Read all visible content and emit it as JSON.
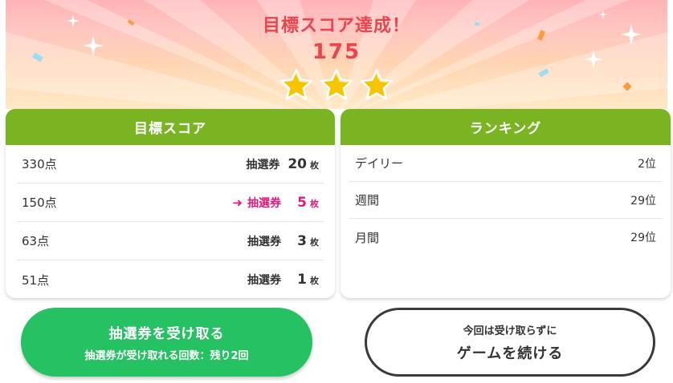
{
  "banner": {
    "title": "目標スコア達成！",
    "score": "175",
    "stars_filled": 3,
    "stars_total": 3,
    "colors": {
      "title": "#e8454f",
      "star": "#f7c500"
    }
  },
  "target_panel": {
    "header": "目標スコア",
    "rows": [
      {
        "score": "330点",
        "prize_label": "抽選券",
        "count": "20",
        "unit": "枚",
        "current": false
      },
      {
        "score": "150点",
        "prize_label": "抽選券",
        "count": "5",
        "unit": "枚",
        "current": true
      },
      {
        "score": "63点",
        "prize_label": "抽選券",
        "count": "3",
        "unit": "枚",
        "current": false
      },
      {
        "score": "51点",
        "prize_label": "抽選券",
        "count": "1",
        "unit": "枚",
        "current": false
      }
    ],
    "current_indicator_icon": "arrow-right-icon",
    "colors": {
      "header": "#7ab422",
      "current": "#e0197d"
    }
  },
  "ranking_panel": {
    "header": "ランキング",
    "rows": [
      {
        "label": "デイリー",
        "value": "2位"
      },
      {
        "label": "週間",
        "value": "29位"
      },
      {
        "label": "月間",
        "value": "29位"
      }
    ]
  },
  "buttons": {
    "receive": {
      "main": "抽選券を受け取る",
      "sub": "抽選券が受け取れる回数：残り2回",
      "color": "#25c162"
    },
    "continue": {
      "sub": "今回は受け取らずに",
      "main": "ゲームを続ける"
    }
  }
}
